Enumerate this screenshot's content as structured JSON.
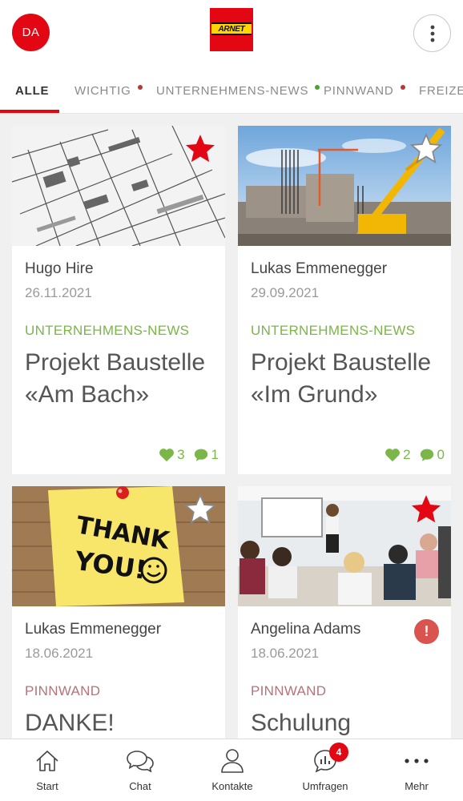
{
  "header": {
    "avatar_initials": "DA",
    "logo_text": "ARNET"
  },
  "tabs": [
    {
      "label": "ALLE",
      "active": true
    },
    {
      "label": "WICHTIG",
      "dot_color": "#b23a3a"
    },
    {
      "label": "UNTERNEHMENS-NEWS",
      "dot_color": "#4aa52e"
    },
    {
      "label": "PINNWAND",
      "dot_color": "#b23a3a"
    },
    {
      "label": "FREIZEIT"
    }
  ],
  "cards": [
    {
      "author": "Hugo Hire",
      "date": "26.11.2021",
      "category": "UNTERNEHMENS-NEWS",
      "title": "Projekt Baustelle «Am Bach»",
      "likes": "3",
      "comments": "1",
      "favorite": true,
      "image": "blueprint"
    },
    {
      "author": "Lukas Emmenegger",
      "date": "29.09.2021",
      "category": "UNTERNEHMENS-NEWS",
      "title": "Projekt Baustelle «Im Grund»",
      "likes": "2",
      "comments": "0",
      "favorite": false,
      "image": "construction-site"
    },
    {
      "author": "Lukas Emmenegger",
      "date": "18.06.2021",
      "category": "PINNWAND",
      "title": "DANKE!",
      "favorite": false,
      "image": "thank-you-note",
      "note_text_1": "THANK",
      "note_text_2": "YOU!"
    },
    {
      "author": "Angelina Adams",
      "date": "18.06.2021",
      "category": "PINNWAND",
      "title": "Schulung",
      "favorite": true,
      "urgent": true,
      "urgent_symbol": "!",
      "image": "training-room"
    }
  ],
  "bottom_nav": [
    {
      "label": "Start",
      "icon": "home-icon"
    },
    {
      "label": "Chat",
      "icon": "chat-icon"
    },
    {
      "label": "Kontakte",
      "icon": "person-icon"
    },
    {
      "label": "Umfragen",
      "icon": "poll-icon",
      "badge": "4"
    },
    {
      "label": "Mehr",
      "icon": "more-icon"
    }
  ],
  "colors": {
    "brand_red": "#e30613",
    "news_green": "#7ab648",
    "pinboard_rose": "#b5737a"
  }
}
